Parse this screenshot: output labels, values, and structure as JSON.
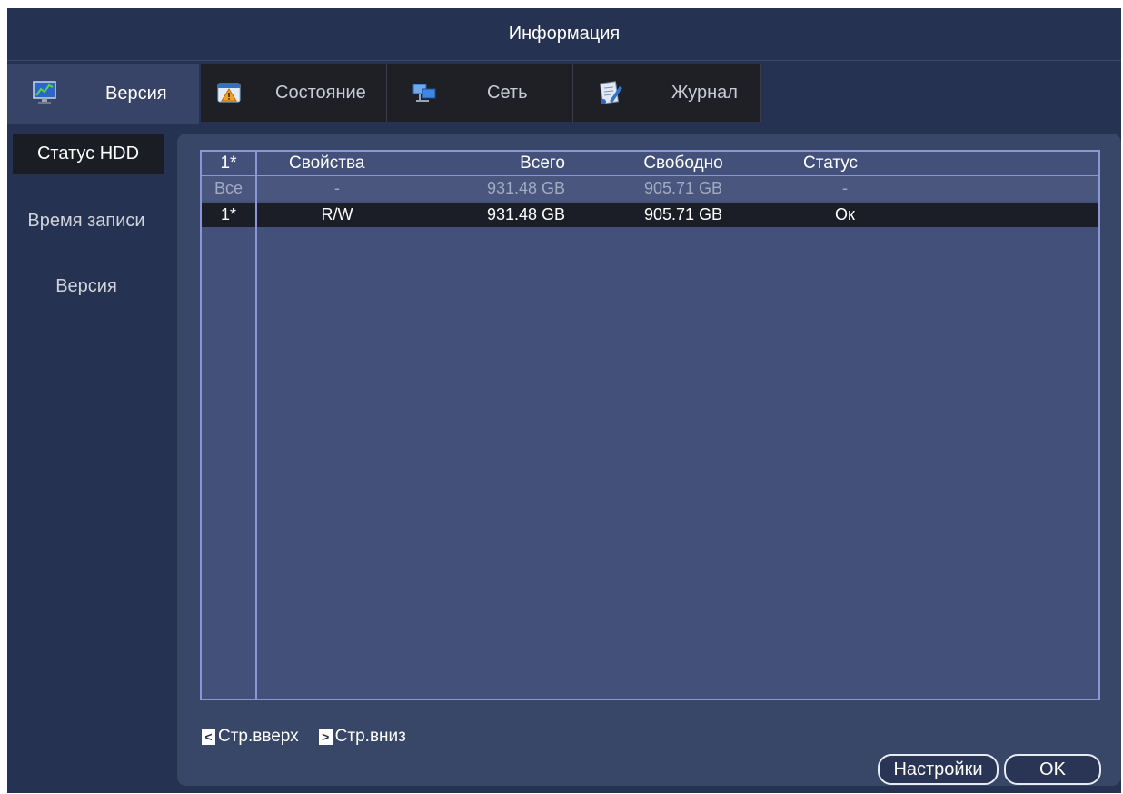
{
  "window": {
    "title": "Информация"
  },
  "tabs": [
    {
      "label": "Версия",
      "icon": "monitor-chart-icon",
      "active": true
    },
    {
      "label": "Состояние",
      "icon": "warning-window-icon",
      "active": false
    },
    {
      "label": "Сеть",
      "icon": "network-computers-icon",
      "active": false
    },
    {
      "label": "Журнал",
      "icon": "notepad-pen-icon",
      "active": false
    }
  ],
  "sidebar": {
    "items": [
      {
        "label": "Статус HDD",
        "active": true
      },
      {
        "label": "Время записи",
        "active": false
      },
      {
        "label": "Версия",
        "active": false
      }
    ]
  },
  "table": {
    "headers": [
      "1*",
      "Свойства",
      "Всего",
      "Свободно",
      "Статус"
    ],
    "rows": [
      [
        "Все",
        "-",
        "931.48 GB",
        "905.71 GB",
        "-"
      ],
      [
        "1*",
        "R/W",
        "931.48 GB",
        "905.71 GB",
        "Ок"
      ]
    ]
  },
  "pager": {
    "prev_glyph": "<",
    "prev_label": "Стр.вверх",
    "next_glyph": ">",
    "next_label": "Стр.вниз"
  },
  "buttons": {
    "settings_label": "Настройки",
    "ok_label": "OK"
  },
  "colors": {
    "background": "#253251",
    "panel": "#384668",
    "table_border": "#8c96d4",
    "selected_row": "#1b1e26"
  }
}
